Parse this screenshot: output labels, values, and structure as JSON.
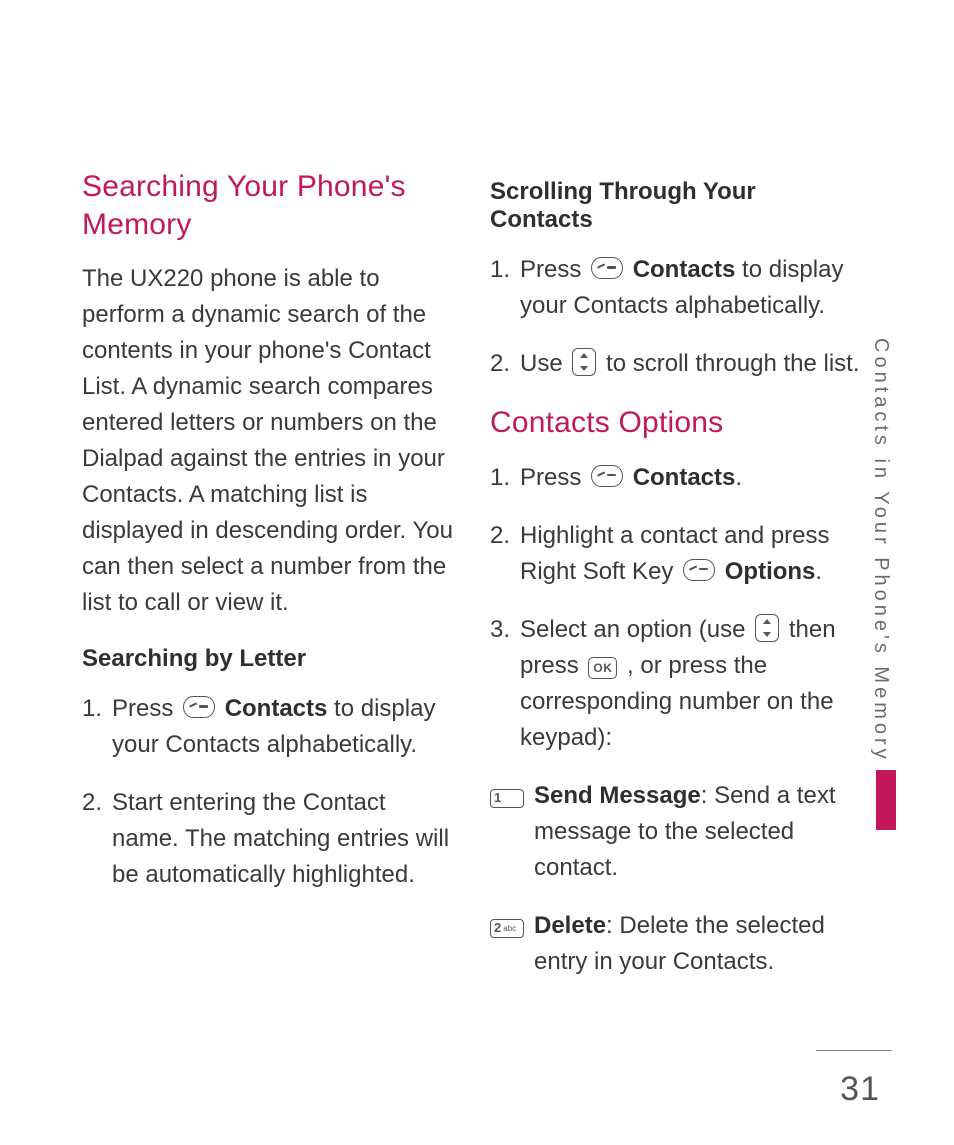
{
  "pageNumber": "31",
  "sideTab": "Contacts in Your Phone's Memory",
  "left": {
    "heading": "Searching Your Phone's Memory",
    "intro": "The UX220 phone is able to perform a dynamic search of the contents in your phone's Contact List. A dynamic search compares entered letters or numbers on the Dialpad against the entries in your Contacts. A matching list is displayed in descending order. You can then select a number from the list to call or view it.",
    "sub1": "Searching by Letter",
    "step1_a": "Press ",
    "step1_b": "Contacts",
    "step1_c": " to display your Contacts alphabetically.",
    "step2": "Start entering the Contact name. The matching entries will be automatically highlighted."
  },
  "right": {
    "sub1": "Scrolling Through Your Contacts",
    "s1_a": "Press ",
    "s1_b": "Contacts",
    "s1_c": "  to display your Contacts alphabetically.",
    "s2_a": "Use ",
    "s2_b": " to scroll through the list.",
    "heading2": "Contacts Options",
    "co1_a": "Press ",
    "co1_b": "Contacts",
    "co1_c": ".",
    "co2_a": "Highlight a contact and press Right Soft Key ",
    "co2_b": "Options",
    "co2_c": ".",
    "co3_a": "Select an option (use ",
    "co3_b": " then press ",
    "co3_c": " , or press the corresponding number on the keypad):",
    "ok": "OK",
    "key1": "1",
    "key1sub": "",
    "opt1_b": "Send Message",
    "opt1_t": ": Send a text message to the selected contact.",
    "key2": "2",
    "key2sub": "abc",
    "opt2_b": "Delete",
    "opt2_t": ": Delete the selected entry in your Contacts."
  }
}
